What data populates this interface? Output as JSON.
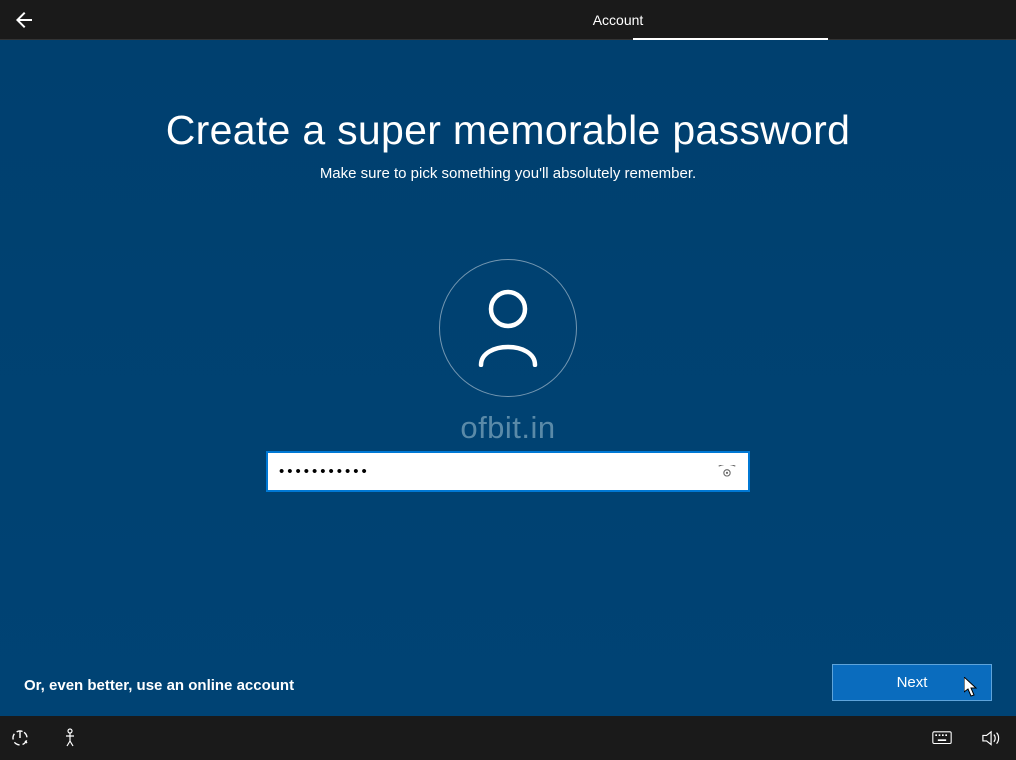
{
  "topbar": {
    "title": "Account"
  },
  "main": {
    "headline": "Create a super memorable password",
    "subtitle": "Make sure to pick something you'll absolutely remember.",
    "watermark": "ofbit.in",
    "password_value": "•••••••••••",
    "online_account_link": "Or, even better, use an online account",
    "next_label": "Next"
  }
}
